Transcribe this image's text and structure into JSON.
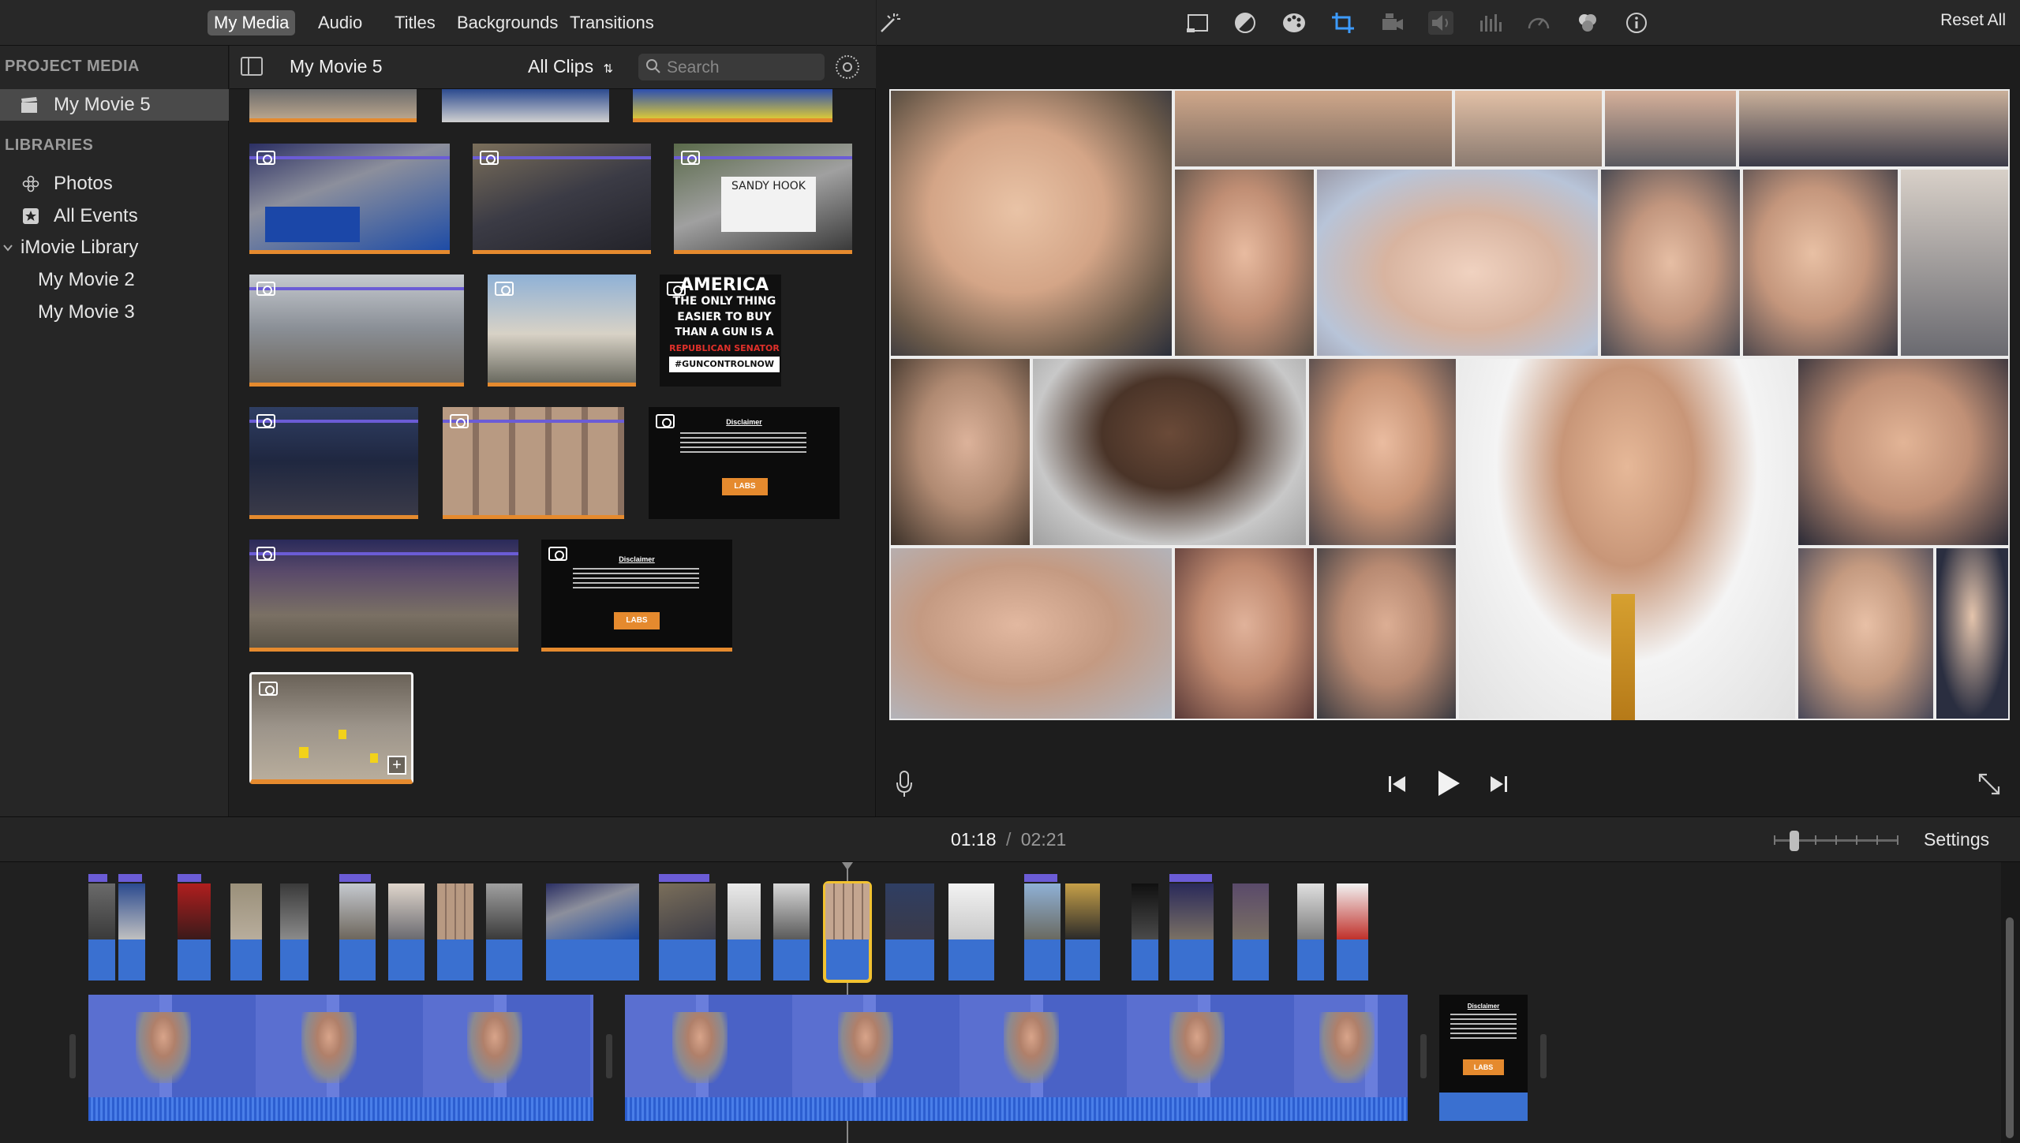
{
  "browser_tabs": [
    "My Media",
    "Audio",
    "Titles",
    "Backgrounds",
    "Transitions"
  ],
  "sidebar": {
    "project_media_header": "PROJECT MEDIA",
    "project_item": "My Movie 5",
    "libraries_header": "LIBRARIES",
    "items": [
      {
        "label": "Photos",
        "icon": "photos-icon"
      },
      {
        "label": "All Events",
        "icon": "star-icon"
      },
      {
        "label": "iMovie Library",
        "icon": "chevron-down-icon"
      },
      {
        "label": "My Movie 2",
        "icon": ""
      },
      {
        "label": "My Movie 3",
        "icon": ""
      }
    ]
  },
  "browser": {
    "title": "My Movie 5",
    "filter": "All Clips",
    "search_placeholder": "Search",
    "thumb_text": {
      "america": [
        "AMERICA",
        "THE ONLY THING",
        "EASIER TO BUY",
        "THAN A GUN IS A",
        "REPUBLICAN SENATOR",
        "#GUNCONTROLNOW"
      ],
      "sign": "SANDY HOOK",
      "disclaimer_title": "Disclaimer",
      "labs": "LABS"
    }
  },
  "viewer": {
    "reset_label": "Reset All"
  },
  "timeline": {
    "current_time": "01:18",
    "separator": "/",
    "total_time": "02:21",
    "settings_label": "Settings"
  },
  "colors": {
    "accent_orange": "#e58a2e",
    "clip_blue": "#3a70d0",
    "selection_yellow": "#f2c230",
    "tag_purple": "#6b5cd6"
  }
}
